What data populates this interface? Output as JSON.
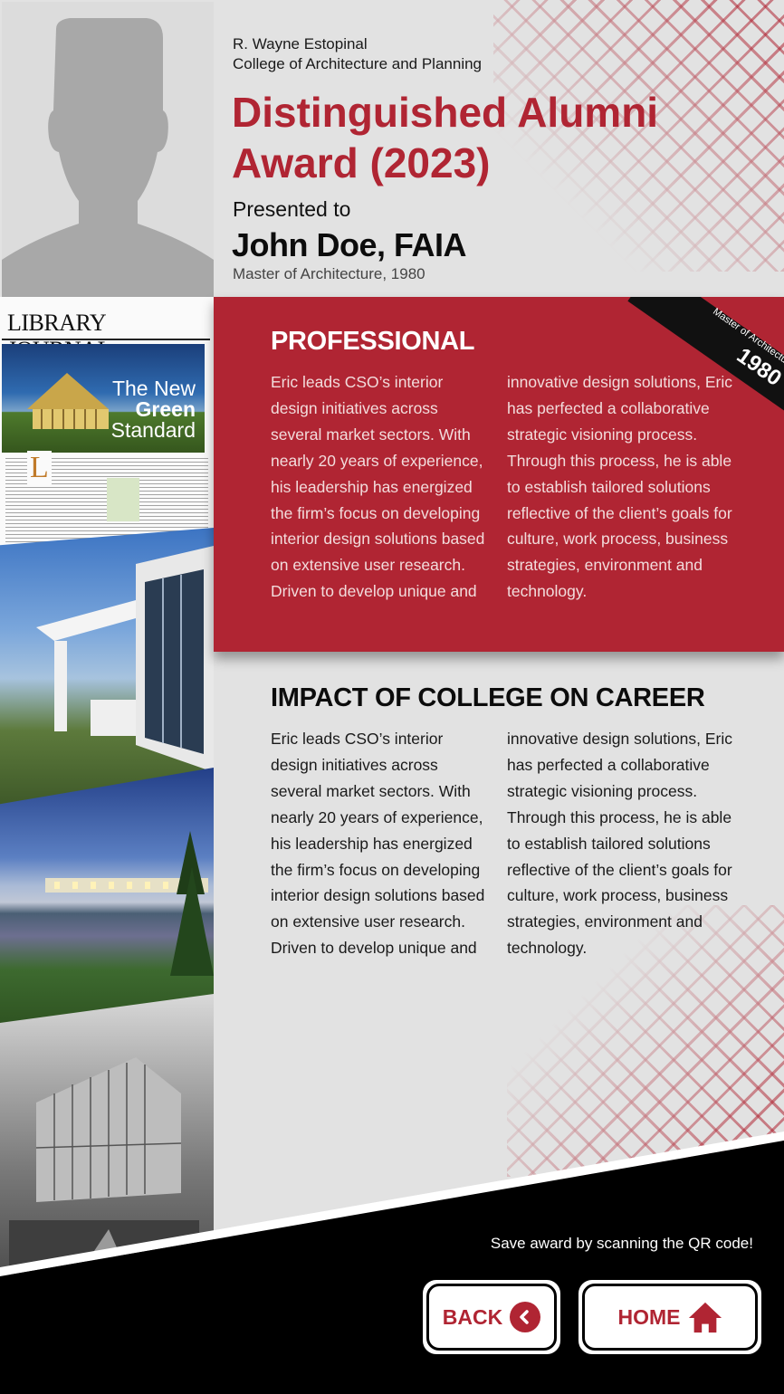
{
  "header": {
    "college_line1": "R. Wayne Estopinal",
    "college_line2": "College of Architecture and Planning",
    "award_line1": "Distinguished Alumni",
    "award_line2": "Award (2023)",
    "presented_to": "Presented to",
    "recipient": "John Doe, FAIA",
    "degree": "Master of Architecture, 1980"
  },
  "gallery": {
    "journal_masthead": "LIBRARY JOURNAL",
    "journal_headline_1": "The New",
    "journal_headline_2": "Green",
    "journal_headline_3": "Standard"
  },
  "professional": {
    "title": "PROFESSIONAL",
    "col1": "Eric leads CSO’s interior design initiatives across several market sectors. With nearly 20 years of experience, his leadership has energized the firm’s focus on developing interior design solutions based on extensive user research. Driven to develop unique and",
    "col2": "innovative design solutions, Eric has perfected a collaborative strategic visioning process. Through this process, he is able to establish tailored solutions reflective of the client’s goals for culture, work process, business strategies, environment and technology."
  },
  "ribbon": {
    "label": "Master of Architecture",
    "year": "1980"
  },
  "impact": {
    "title": "IMPACT OF COLLEGE ON CAREER",
    "col1": "Eric leads CSO’s interior design initiatives across several market sectors. With nearly 20 years of experience, his leadership has energized the firm’s focus on developing interior design solutions based on extensive user research. Driven to develop unique and",
    "col2": "innovative design solutions, Eric has perfected a collaborative strategic visioning process. Through this process, he is able to establish tailored solutions reflective of the client’s goals for culture, work process, business strategies, environment and technology."
  },
  "footer": {
    "qr_text": "Save award by scanning the QR code!",
    "back_label": "BACK",
    "home_label": "HOME"
  },
  "icons": {
    "back": "chevron-left-icon",
    "home": "home-icon"
  },
  "colors": {
    "accent": "#b02533",
    "background": "#e2e2e2",
    "footer": "#000000"
  }
}
